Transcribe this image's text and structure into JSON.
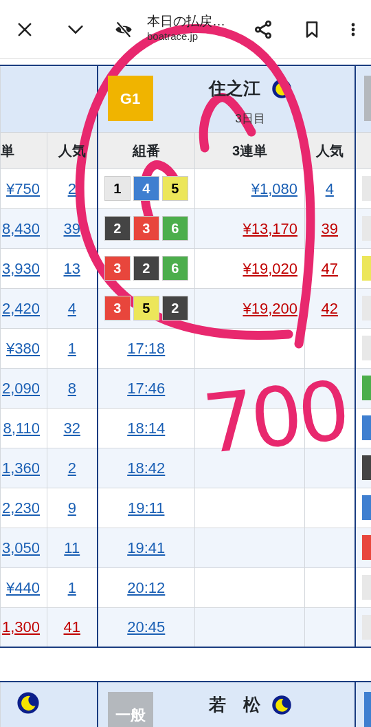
{
  "browser_bar": {
    "title": "本日の払戻…",
    "url": "boatrace.jp"
  },
  "left_venue": {
    "columns": [
      "単",
      "人気"
    ],
    "rows": [
      {
        "payout": "¥750",
        "popularity": "2",
        "high": false
      },
      {
        "payout": "8,430",
        "popularity": "39",
        "high": false
      },
      {
        "payout": "3,930",
        "popularity": "13",
        "high": false
      },
      {
        "payout": "2,420",
        "popularity": "4",
        "high": false
      },
      {
        "payout": "¥380",
        "popularity": "1",
        "high": false
      },
      {
        "payout": "2,090",
        "popularity": "8",
        "high": false
      },
      {
        "payout": "8,110",
        "popularity": "32",
        "high": false
      },
      {
        "payout": "1,360",
        "popularity": "2",
        "high": false
      },
      {
        "payout": "2,230",
        "popularity": "9",
        "high": false
      },
      {
        "payout": "3,050",
        "popularity": "11",
        "high": false
      },
      {
        "payout": "¥440",
        "popularity": "1",
        "high": false
      },
      {
        "payout": "1,300",
        "popularity": "41",
        "high": true
      }
    ]
  },
  "main_venue": {
    "grade": {
      "label": "G1",
      "color": "#f0b400"
    },
    "name": "住之江",
    "night": true,
    "day": "3日目",
    "columns": [
      "組番",
      "3連単",
      "人気"
    ],
    "rows": [
      {
        "kind": "result",
        "boats": [
          {
            "number": "1",
            "color": "#e8e8e8"
          },
          {
            "number": "4",
            "color": "#3f7fd0"
          },
          {
            "number": "5",
            "color": "#ece65a"
          }
        ],
        "payout": "¥1,080",
        "popularity": "4",
        "high": false
      },
      {
        "kind": "result",
        "boats": [
          {
            "number": "2",
            "color": "#444444"
          },
          {
            "number": "3",
            "color": "#e8463c"
          },
          {
            "number": "6",
            "color": "#4cae4c"
          }
        ],
        "payout": "¥13,170",
        "popularity": "39",
        "high": true
      },
      {
        "kind": "result",
        "boats": [
          {
            "number": "3",
            "color": "#e8463c"
          },
          {
            "number": "2",
            "color": "#444444"
          },
          {
            "number": "6",
            "color": "#4cae4c"
          }
        ],
        "payout": "¥19,020",
        "popularity": "47",
        "high": true
      },
      {
        "kind": "result",
        "boats": [
          {
            "number": "3",
            "color": "#e8463c"
          },
          {
            "number": "5",
            "color": "#ece65a"
          },
          {
            "number": "2",
            "color": "#444444"
          }
        ],
        "payout": "¥19,200",
        "popularity": "42",
        "high": true
      },
      {
        "kind": "scheduled",
        "time": "17:18"
      },
      {
        "kind": "scheduled",
        "time": "17:46"
      },
      {
        "kind": "scheduled",
        "time": "18:14"
      },
      {
        "kind": "scheduled",
        "time": "18:42"
      },
      {
        "kind": "scheduled",
        "time": "19:11"
      },
      {
        "kind": "scheduled",
        "time": "19:41"
      },
      {
        "kind": "scheduled",
        "time": "20:12"
      },
      {
        "kind": "scheduled",
        "time": "20:45"
      }
    ]
  },
  "right_venue": {
    "header": {
      "color": "#b4b8bd"
    },
    "rows": [
      {
        "color": "#e8e8e8"
      },
      {
        "color": "#e8e8e8"
      },
      {
        "color": "#ece65a"
      },
      {
        "color": "#e8e8e8"
      },
      {
        "color": "#e8e8e8"
      },
      {
        "color": "#4cae4c"
      },
      {
        "color": "#3f7fd0"
      },
      {
        "color": "#444444"
      },
      {
        "color": "#3f7fd0"
      },
      {
        "color": "#e8463c"
      },
      {
        "color": "#e8e8e8"
      },
      {
        "color": "#e8e8e8"
      }
    ]
  },
  "next_row": {
    "left": {
      "night": true
    },
    "main": {
      "grade": {
        "label": "一般",
        "color": "#b4b8bd"
      },
      "name": "若　松",
      "night": true
    },
    "right": {
      "color": "#3f7fd0"
    }
  },
  "annotation": {
    "text": "700"
  }
}
